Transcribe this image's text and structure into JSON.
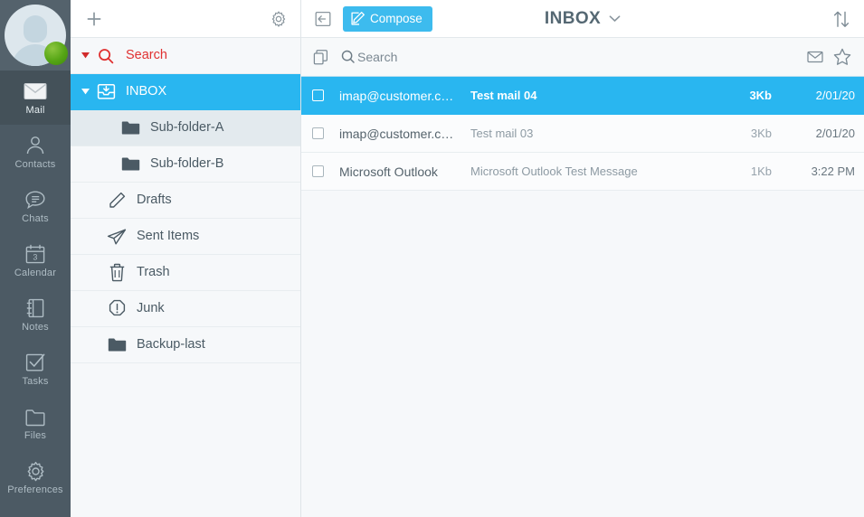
{
  "rail": {
    "avatar": {
      "name": "user-avatar",
      "status": "online",
      "status_color": "#55a515"
    },
    "items": [
      {
        "label": "Mail",
        "icon": "mail-icon",
        "active": true
      },
      {
        "label": "Contacts",
        "icon": "contacts-icon",
        "active": false
      },
      {
        "label": "Chats",
        "icon": "chats-icon",
        "active": false
      },
      {
        "label": "Calendar",
        "icon": "calendar-icon",
        "active": false,
        "day": "3"
      },
      {
        "label": "Notes",
        "icon": "notes-icon",
        "active": false
      },
      {
        "label": "Tasks",
        "icon": "tasks-icon",
        "active": false
      },
      {
        "label": "Files",
        "icon": "files-icon",
        "active": false
      },
      {
        "label": "Preferences",
        "icon": "gear-icon",
        "active": false
      }
    ]
  },
  "folders": {
    "toolbar": {
      "add_label": "+",
      "add_icon": "plus-icon",
      "settings_icon": "gear-icon"
    },
    "items": [
      {
        "label": "Search",
        "icon": "search-icon",
        "kind": "search",
        "twisty": true
      },
      {
        "label": "INBOX",
        "icon": "inbox-icon",
        "kind": "inbox",
        "twisty": true,
        "selected": true
      },
      {
        "label": "Sub-folder-A",
        "icon": "folder-icon",
        "kind": "sub",
        "hover": true
      },
      {
        "label": "Sub-folder-B",
        "icon": "folder-icon",
        "kind": "sub"
      },
      {
        "label": "Drafts",
        "icon": "pencil-icon",
        "kind": "top"
      },
      {
        "label": "Sent Items",
        "icon": "paper-plane-icon",
        "kind": "top"
      },
      {
        "label": "Trash",
        "icon": "trash-icon",
        "kind": "top"
      },
      {
        "label": "Junk",
        "icon": "warning-octagon-icon",
        "kind": "top"
      },
      {
        "label": "Backup-last",
        "icon": "folder-icon",
        "kind": "top"
      }
    ]
  },
  "maillist": {
    "toolbar": {
      "collapse_icon": "collapse-panel-icon",
      "compose_label": "Compose",
      "compose_icon": "compose-pencil-icon",
      "title": "INBOX",
      "title_caret_icon": "chevron-down-icon",
      "sort_icon": "sort-updown-icon"
    },
    "search": {
      "multiselect_icon": "copy-select-icon",
      "search_icon": "search-icon",
      "placeholder": "Search",
      "value": "",
      "unread_icon": "envelope-icon",
      "flag_icon": "star-icon"
    },
    "messages": [
      {
        "sender": "imap@customer.c…",
        "subject": "Test mail 04",
        "size": "3Kb",
        "date": "2/01/20",
        "selected": true,
        "unread": true
      },
      {
        "sender": "imap@customer.c…",
        "subject": "Test mail 03",
        "size": "3Kb",
        "date": "2/01/20",
        "selected": false,
        "unread": false
      },
      {
        "sender": "Microsoft Outlook",
        "subject": "Microsoft Outlook Test Message",
        "size": "1Kb",
        "date": "3:22 PM",
        "selected": false,
        "unread": false
      }
    ]
  },
  "colors": {
    "accent": "#29b6f0",
    "compose": "#3dbbee",
    "rail_bg": "#4c5a64",
    "rail_active": "#445159",
    "search_red": "#e03131",
    "panel_bg": "#f6f8fa"
  }
}
